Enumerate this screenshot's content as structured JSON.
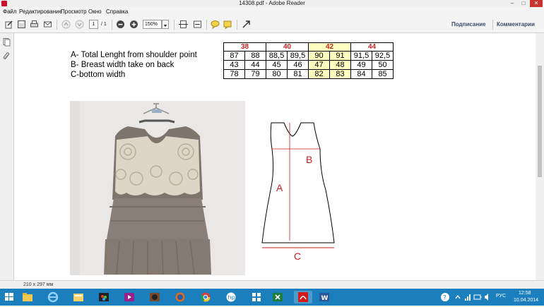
{
  "window": {
    "title": "14308.pdf - Adobe Reader",
    "minimize": "–",
    "maximize": "□",
    "close": "✕"
  },
  "menu": [
    "Файл",
    "Редактирование",
    "Просмотр",
    "Окно",
    "Справка"
  ],
  "toolbar": {
    "page_current": "1",
    "page_total": "/ 1",
    "zoom_value": "150%",
    "sign_label": "Подписание",
    "comments_label": "Комментарии"
  },
  "document": {
    "spec_lines": [
      "A- Total Lenght from shoulder point",
      "B- Breast width take on back",
      "C-bottom width"
    ],
    "size_table": {
      "headers": [
        "38",
        "40",
        "42",
        "44"
      ],
      "highlight_index": 2,
      "rows": [
        [
          "87",
          "88",
          "88,5",
          "89,5",
          "90",
          "91",
          "91,5",
          "92,5"
        ],
        [
          "43",
          "44",
          "45",
          "46",
          "47",
          "48",
          "49",
          "50"
        ],
        [
          "78",
          "79",
          "80",
          "81",
          "82",
          "83",
          "84",
          "85"
        ]
      ]
    },
    "diagram_labels": {
      "a": "A",
      "b": "B",
      "c": "C"
    },
    "colors": {
      "header_red": "#cc2222",
      "highlight": "#ffffc0",
      "diagram_red": "#c81e1e"
    }
  },
  "status": {
    "page_size": "210 x 297 мм"
  },
  "taskbar": {
    "apps": [
      "file-explorer",
      "internet-explorer",
      "file-manager",
      "photo-app",
      "media-player",
      "media-app",
      "firefox",
      "chrome",
      "hp-app",
      "app-grid",
      "excel",
      "adobe-reader",
      "word"
    ],
    "lang": "РУС",
    "time": "12:58",
    "date": "10.04.2014",
    "help": "?"
  }
}
